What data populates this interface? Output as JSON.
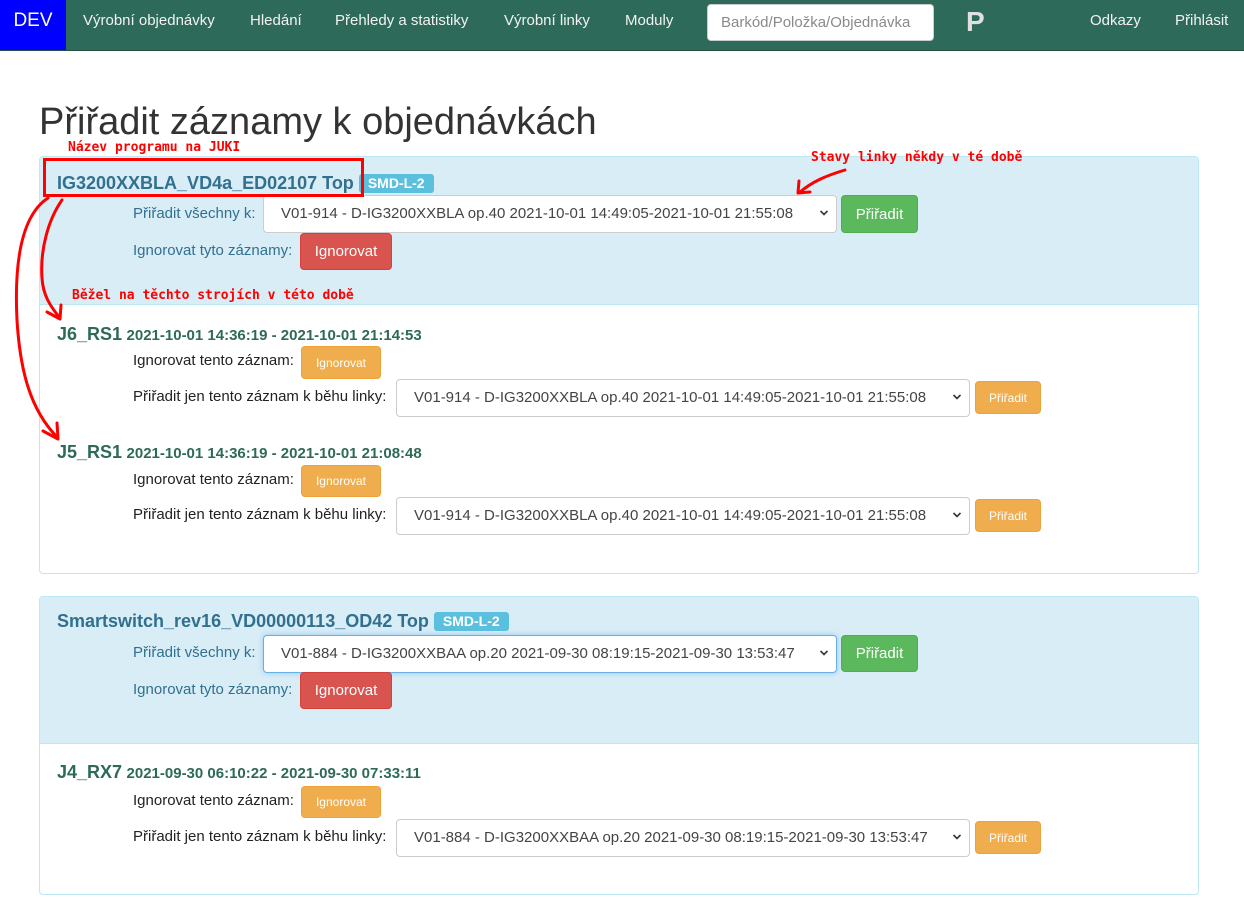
{
  "nav": {
    "brand": "DEV",
    "items": [
      "Výrobní objednávky",
      "Hledání",
      "Přehledy a statistiky",
      "Výrobní linky",
      "Moduly"
    ],
    "search_placeholder": "Barkód/Položka/Objednávka",
    "logo": "P",
    "right_items": [
      "Odkazy",
      "Přihlásit"
    ]
  },
  "page_title": "Přiřadit záznamy k objednávkách",
  "labels": {
    "assign_all": "Přiřadit všechny k:",
    "ignore_all": "Ignorovat tyto záznamy:",
    "ignore_one": "Ignorovat tento záznam:",
    "assign_one": "Přiřadit jen tento záznam k běhu linky:",
    "assign_button": "Přiřadit",
    "ignore_button": "Ignorovat"
  },
  "groups": [
    {
      "program": "IG3200XXBLA_VD4a_ED02107 Top",
      "line": "SMD-L-2",
      "assign_all_value": "V01-914 - D-IG3200XXBLA op.40 2021-10-01 14:49:05-2021-10-01 21:55:08",
      "records": [
        {
          "machine": "J6_RS1",
          "time": "2021-10-01 14:36:19 - 2021-10-01 21:14:53",
          "assign_value": "V01-914 - D-IG3200XXBLA op.40 2021-10-01 14:49:05-2021-10-01 21:55:08"
        },
        {
          "machine": "J5_RS1",
          "time": "2021-10-01 14:36:19 - 2021-10-01 21:08:48",
          "assign_value": "V01-914 - D-IG3200XXBLA op.40 2021-10-01 14:49:05-2021-10-01 21:55:08"
        }
      ]
    },
    {
      "program": "Smartswitch_rev16_VD00000113_OD42 Top",
      "line": "SMD-L-2",
      "assign_all_value": "V01-884 - D-IG3200XXBAA op.20 2021-09-30 08:19:15-2021-09-30 13:53:47",
      "records": [
        {
          "machine": "J4_RX7",
          "time": "2021-09-30 06:10:22 - 2021-09-30 07:33:11",
          "assign_value": "V01-884 - D-IG3200XXBAA op.20 2021-09-30 08:19:15-2021-09-30 13:53:47"
        }
      ]
    }
  ],
  "annotations": {
    "program_name": "Název programu na JUKI",
    "line_states": "Stavy linky někdy v té době",
    "machines": "Běžel na těchto strojích v této době"
  },
  "colors": {
    "navbar": "#2e6a59",
    "brand": "#0000ff",
    "panel_heading": "#d9edf7",
    "success": "#5cb85c",
    "danger": "#d9534f",
    "warning": "#f0ad4e",
    "badge": "#5bc0de",
    "annotation": "#ff0000"
  },
  "icons": {
    "select_arrow": "chevron-down-icon",
    "annotation_arrows": "arrow-icon"
  }
}
